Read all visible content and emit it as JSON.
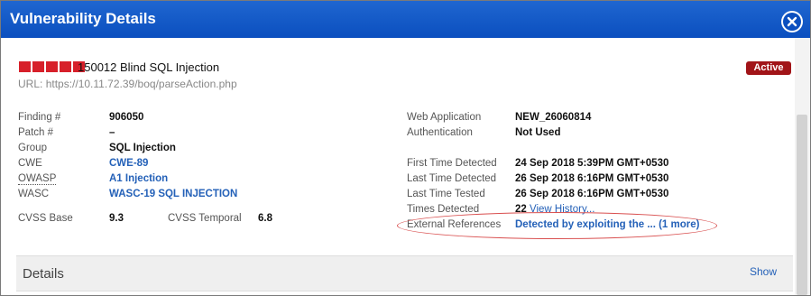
{
  "window": {
    "title": "Vulnerability Details",
    "close_icon": "close-icon"
  },
  "vulnerability": {
    "severity_level": 5,
    "severity_color": "#d7202a",
    "qid_title": "150012 Blind SQL Injection",
    "status": "Active",
    "status_color": "#a11418",
    "url_label": "URL:",
    "url": "https://10.11.72.39/boq/parseAction.php"
  },
  "left_fields": {
    "finding": {
      "label": "Finding #",
      "value": "906050"
    },
    "patch": {
      "label": "Patch #",
      "value": "–"
    },
    "group": {
      "label": "Group",
      "value": "SQL Injection"
    },
    "cwe": {
      "label": "CWE",
      "value": "CWE-89"
    },
    "owasp": {
      "label": "OWASP",
      "value": "A1 Injection"
    },
    "wasc": {
      "label": "WASC",
      "value": "WASC-19 SQL INJECTION"
    },
    "cvss_base": {
      "label": "CVSS Base",
      "value": "9.3"
    },
    "cvss_temporal": {
      "label": "CVSS Temporal",
      "value": "6.8"
    }
  },
  "right_fields": {
    "web_application": {
      "label": "Web Application",
      "value": "NEW_26060814"
    },
    "authentication": {
      "label": "Authentication",
      "value": "Not Used"
    },
    "first_detected": {
      "label": "First Time Detected",
      "value": "24 Sep 2018 5:39PM GMT+0530"
    },
    "last_detected": {
      "label": "Last Time Detected",
      "value": "26 Sep 2018 6:16PM GMT+0530"
    },
    "last_tested": {
      "label": "Last Time Tested",
      "value": "26 Sep 2018 6:16PM GMT+0530"
    },
    "times_detected": {
      "label": "Times Detected",
      "value": "22",
      "link": "View History..."
    },
    "external_refs": {
      "label": "External References",
      "value": "Detected by exploiting the ... (1 more)"
    }
  },
  "details_section": {
    "title": "Details",
    "show_label": "Show"
  },
  "colors": {
    "title_bar": "#0b4fbf",
    "link": "#2461b8",
    "annotation": "#d95050"
  }
}
